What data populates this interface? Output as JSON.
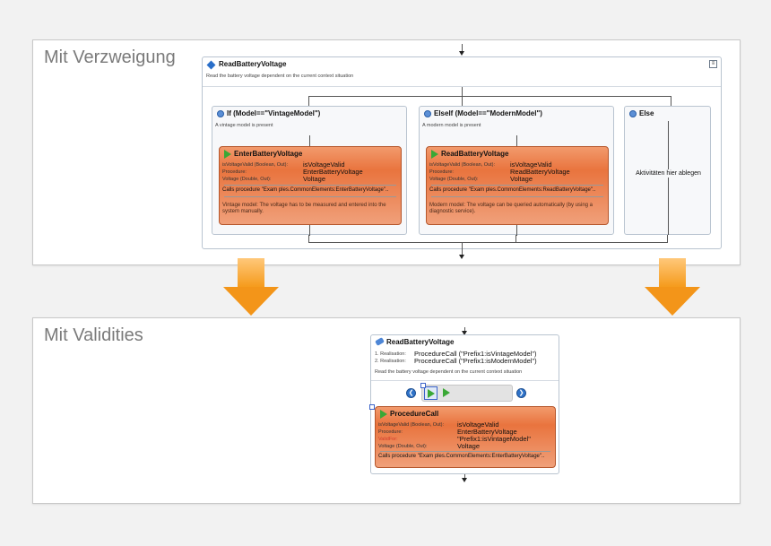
{
  "top": {
    "title": "Mit Verzweigung",
    "main_box": {
      "title": "ReadBatteryVoltage",
      "description": "Read the battery voltage dependent on the current context situation"
    },
    "branches": [
      {
        "title": "If (Model==\"VintageModel\")",
        "note": "A vintage model is present",
        "activity": {
          "title": "EnterBatteryVoltage",
          "rows": [
            {
              "label": "isVoltageValid (Boolean, Out):",
              "value": "isVoltageValid"
            },
            {
              "label": "Procedure:",
              "value": "EnterBatteryVoltage"
            },
            {
              "label": "Voltage (Double, Out):",
              "value": "Voltage"
            }
          ],
          "calls": "Calls  procedure \"Exam ples.CommonElements:EnterBatteryVoltage\"..",
          "comment": "Vintage model: The voltage has to be measured and entered into the system manually."
        }
      },
      {
        "title": "ElseIf (Model==\"ModernModel\")",
        "note": "A modern model is present",
        "activity": {
          "title": "ReadBatteryVoltage",
          "rows": [
            {
              "label": "isVoltageValid (Boolean, Out):",
              "value": "isVoltageValid"
            },
            {
              "label": "Procedure:",
              "value": "ReadBatteryVoltage"
            },
            {
              "label": "Voltage (Double, Out):",
              "value": "Voltage"
            }
          ],
          "calls": "Calls  procedure \"Exam ples.CommonElements:ReadBatteryVoltage\"..",
          "comment": "Modern model: The voltage can be queried automatically (by using a diagnostic service)."
        }
      },
      {
        "title": "Else",
        "placeholder": "Aktivitäten hier ablegen"
      }
    ]
  },
  "bottom": {
    "title": "Mit Validities",
    "box": {
      "title": "ReadBatteryVoltage",
      "realisations": [
        {
          "label": "1. Realisation:",
          "value": "ProcedureCall (\"Prefix1:isVintageModel\")"
        },
        {
          "label": "2. Realisation:",
          "value": "ProcedureCall (\"Prefix1:isModernModel\")"
        }
      ],
      "description": "Read the battery voltage dependent on the current context situation"
    },
    "activity": {
      "title": "ProcedureCall",
      "rows": [
        {
          "label": "isVoltageValid (Boolean, Out):",
          "value": "isVoltageValid"
        },
        {
          "label": "Procedure:",
          "value": "EnterBatteryVoltage"
        },
        {
          "label": "ValidFor:",
          "value": "\"Prefix1:isVintageModel\"",
          "highlight": true
        },
        {
          "label": "Voltage (Double, Out):",
          "value": "Voltage"
        }
      ],
      "calls": "Calls  procedure \"Exam ples.CommonElements:EnterBatteryVoltage\".."
    }
  },
  "colors": {
    "activity_orange": "#e9743e",
    "arrow_orange": "#f39519",
    "valid_for_red": "#d23a2a",
    "play_green": "#3aa836"
  },
  "icons": {
    "main": "blue-diamond-icon",
    "branch": "gear-icon",
    "activity": "green-play-icon",
    "nav_prev": "chevron-left-icon",
    "nav_next": "chevron-right-icon",
    "collapse": "collapse-icon"
  }
}
